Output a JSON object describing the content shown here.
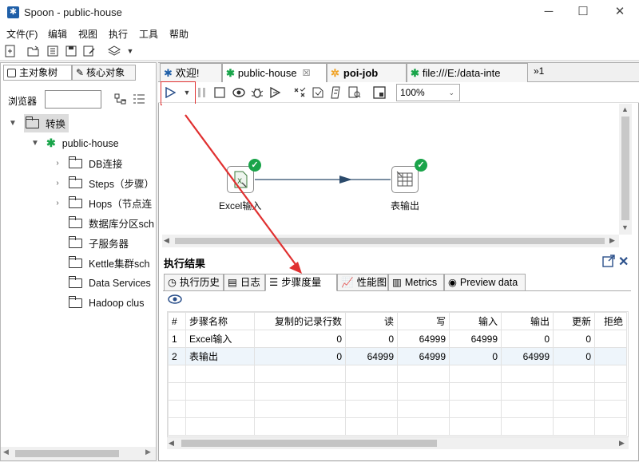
{
  "window": {
    "title": "Spoon - public-house",
    "minimize": "─",
    "maximize": "☐",
    "close": "✕"
  },
  "menu": [
    "文件(F)",
    "编辑",
    "视图",
    "执行",
    "工具",
    "帮助"
  ],
  "left_tabs": {
    "main_tree": "主对象树",
    "core_objects": "核心对象"
  },
  "browser": {
    "label": "浏览器",
    "search_value": ""
  },
  "tree": {
    "root": "转换",
    "transformation": "public-house",
    "children": [
      "DB连接",
      "Steps（步骤）",
      "Hops（节点连",
      "数据库分区sch",
      "子服务器",
      "Kettle集群sch",
      "Data Services",
      "Hadoop clus"
    ]
  },
  "editor_tabs": [
    "欢迎!",
    "public-house",
    "poi-job",
    "file:///E:/data-inte"
  ],
  "editor_tabs_overflow": "»1",
  "zoom": {
    "value": "100%"
  },
  "canvas": {
    "steps": [
      {
        "name": "Excel输入",
        "status": "success"
      },
      {
        "name": "表输出",
        "status": "success"
      }
    ]
  },
  "results": {
    "title": "执行结果",
    "tabs": [
      "执行历史",
      "日志",
      "步骤度量",
      "性能图",
      "Metrics",
      "Preview data"
    ],
    "columns": [
      "#",
      "步骤名称",
      "复制的记录行数",
      "读",
      "写",
      "输入",
      "输出",
      "更新",
      "拒绝"
    ],
    "rows": [
      [
        "1",
        "Excel输入",
        "0",
        "0",
        "64999",
        "64999",
        "0",
        "0",
        ""
      ],
      [
        "2",
        "表输出",
        "0",
        "64999",
        "64999",
        "0",
        "64999",
        "0",
        ""
      ]
    ]
  },
  "colors": {
    "accent_red": "#e03030",
    "success_green": "#1aa44a",
    "hop_blue": "#2b4a6b"
  }
}
